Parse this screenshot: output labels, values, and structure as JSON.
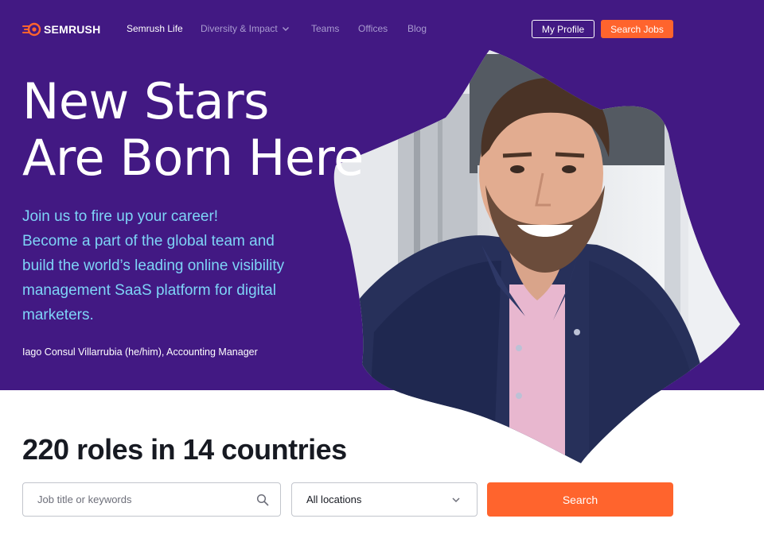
{
  "brand": {
    "name": "SEMRUSH",
    "accent": "#ff642d",
    "hero_bg": "#421983",
    "sub_color": "#7ed4f7"
  },
  "nav": {
    "links": [
      {
        "label": "Semrush Life",
        "active": true
      },
      {
        "label": "Diversity & Impact",
        "has_dropdown": true
      },
      {
        "label": "Teams"
      },
      {
        "label": "Offices"
      },
      {
        "label": "Blog"
      }
    ],
    "my_profile": "My Profile",
    "search_jobs": "Search Jobs"
  },
  "hero": {
    "headline_line1": "New Stars",
    "headline_line2": "Are Born Here",
    "sub_lines": [
      "Join us to fire up your career!",
      "Become a part of the global team and",
      "build the world’s leading online visibility",
      "management SaaS platform for digital",
      "marketers."
    ],
    "caption": "Iago Consul Villarrubia (he/him), Accounting Manager"
  },
  "search": {
    "heading": "220 roles in 14 countries",
    "keywords_placeholder": "Job title or keywords",
    "location_value": "All locations",
    "button": "Search"
  }
}
